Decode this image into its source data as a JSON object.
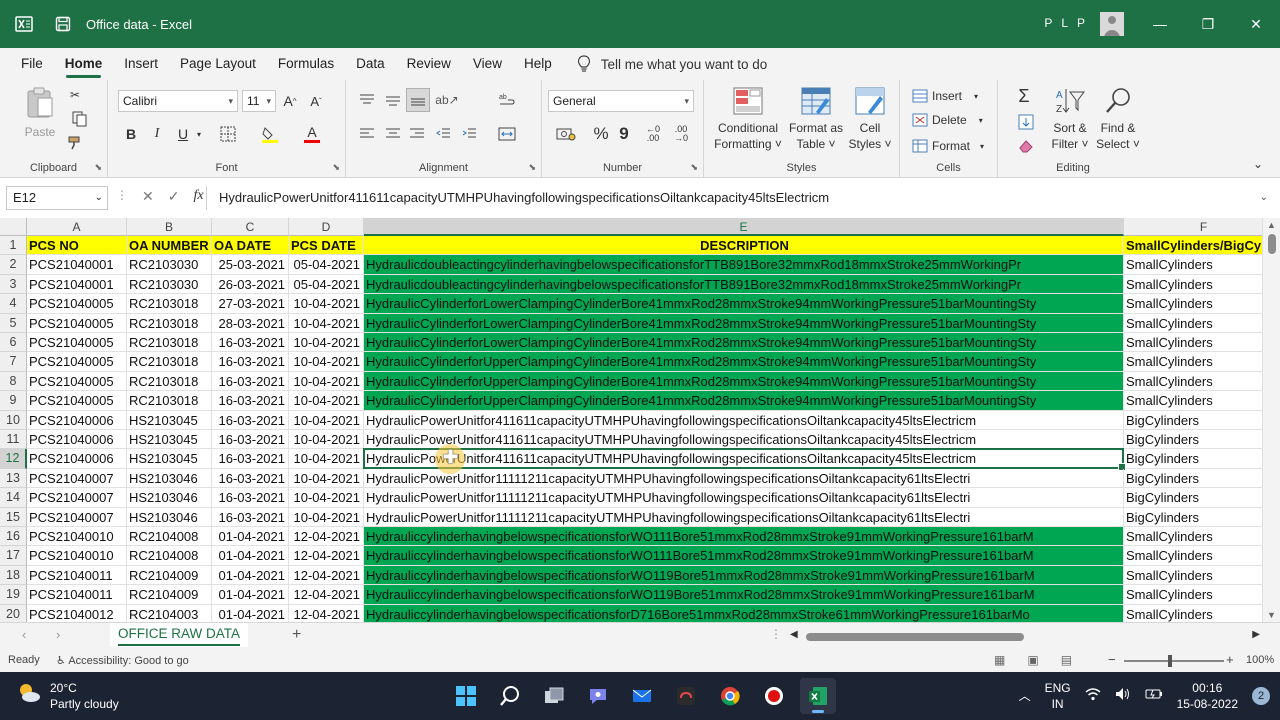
{
  "titlebar": {
    "doc_title": "Office data  -  Excel",
    "user": "P L P",
    "minimize": "—",
    "restore": "❐",
    "close": "✕"
  },
  "menu": {
    "tabs": [
      "File",
      "Home",
      "Insert",
      "Page Layout",
      "Formulas",
      "Data",
      "Review",
      "View",
      "Help"
    ],
    "tellme": "Tell me what you want to do"
  },
  "ribbon": {
    "clipboard": {
      "label": "Clipboard",
      "paste": "Paste"
    },
    "font": {
      "label": "Font",
      "name": "Calibri",
      "size": "11",
      "bold": "B",
      "italic": "I",
      "underline": "U"
    },
    "alignment": {
      "label": "Alignment"
    },
    "number": {
      "label": "Number",
      "format": "General",
      "percent": "%",
      "comma": "9"
    },
    "styles": {
      "label": "Styles",
      "conditional": [
        "Conditional",
        "Formatting ˅"
      ],
      "format_table": [
        "Format as",
        "Table ˅"
      ],
      "cell_styles": [
        "Cell",
        "Styles ˅"
      ]
    },
    "cells": {
      "label": "Cells",
      "insert": "Insert",
      "delete": "Delete",
      "format": "Format"
    },
    "editing": {
      "label": "Editing",
      "sort": [
        "Sort &",
        "Filter ˅"
      ],
      "find": [
        "Find &",
        "Select ˅"
      ]
    }
  },
  "formula_bar": {
    "name_box": "E12",
    "content": "HydraulicPowerUnitfor411611capacityUTMHPUhavingfollowingspecificationsOiltankcapacity45ltsElectricm"
  },
  "columns": [
    "A",
    "B",
    "C",
    "D",
    "E",
    "F"
  ],
  "rows": [
    {
      "n": "1",
      "a": "PCS NO",
      "b": "OA NUMBER",
      "c": "OA DATE",
      "d": "PCS DATE",
      "e": "DESCRIPTION",
      "f": "SmallCylinders/BigCylinders",
      "hdr": true
    },
    {
      "n": "2",
      "a": "PCS21040001",
      "b": "RC2103030",
      "c": "25-03-2021",
      "d": "05-04-2021",
      "e": "HydraulicdoubleactingcylinderhavingbelowspecificationsforTTB891Bore32mmxRod18mmxStroke25mmWorkingPr",
      "f": "SmallCylinders",
      "green": true
    },
    {
      "n": "3",
      "a": "PCS21040001",
      "b": "RC2103030",
      "c": "26-03-2021",
      "d": "05-04-2021",
      "e": "HydraulicdoubleactingcylinderhavingbelowspecificationsforTTB891Bore32mmxRod18mmxStroke25mmWorkingPr",
      "f": "SmallCylinders",
      "green": true
    },
    {
      "n": "4",
      "a": "PCS21040005",
      "b": "RC2103018",
      "c": "27-03-2021",
      "d": "10-04-2021",
      "e": "HydraulicCylinderforLowerClampingCylinderBore41mmxRod28mmxStroke94mmWorkingPressure51barMountingSty",
      "f": "SmallCylinders",
      "green": true
    },
    {
      "n": "5",
      "a": "PCS21040005",
      "b": "RC2103018",
      "c": "28-03-2021",
      "d": "10-04-2021",
      "e": "HydraulicCylinderforLowerClampingCylinderBore41mmxRod28mmxStroke94mmWorkingPressure51barMountingSty",
      "f": "SmallCylinders",
      "green": true
    },
    {
      "n": "6",
      "a": "PCS21040005",
      "b": "RC2103018",
      "c": "16-03-2021",
      "d": "10-04-2021",
      "e": "HydraulicCylinderforLowerClampingCylinderBore41mmxRod28mmxStroke94mmWorkingPressure51barMountingSty",
      "f": "SmallCylinders",
      "green": true
    },
    {
      "n": "7",
      "a": "PCS21040005",
      "b": "RC2103018",
      "c": "16-03-2021",
      "d": "10-04-2021",
      "e": "HydraulicCylinderforUpperClampingCylinderBore41mmxRod28mmxStroke94mmWorkingPressure51barMountingSty",
      "f": "SmallCylinders",
      "green": true
    },
    {
      "n": "8",
      "a": "PCS21040005",
      "b": "RC2103018",
      "c": "16-03-2021",
      "d": "10-04-2021",
      "e": "HydraulicCylinderforUpperClampingCylinderBore41mmxRod28mmxStroke94mmWorkingPressure51barMountingSty",
      "f": "SmallCylinders",
      "green": true
    },
    {
      "n": "9",
      "a": "PCS21040005",
      "b": "RC2103018",
      "c": "16-03-2021",
      "d": "10-04-2021",
      "e": "HydraulicCylinderforUpperClampingCylinderBore41mmxRod28mmxStroke94mmWorkingPressure51barMountingSty",
      "f": "SmallCylinders",
      "green": true
    },
    {
      "n": "10",
      "a": "PCS21040006",
      "b": "HS2103045",
      "c": "16-03-2021",
      "d": "10-04-2021",
      "e": "HydraulicPowerUnitfor411611capacityUTMHPUhavingfollowingspecificationsOiltankcapacity45ltsElectricm",
      "f": "BigCylinders"
    },
    {
      "n": "11",
      "a": "PCS21040006",
      "b": "HS2103045",
      "c": "16-03-2021",
      "d": "10-04-2021",
      "e": "HydraulicPowerUnitfor411611capacityUTMHPUhavingfollowingspecificationsOiltankcapacity45ltsElectricm",
      "f": "BigCylinders"
    },
    {
      "n": "12",
      "a": "PCS21040006",
      "b": "HS2103045",
      "c": "16-03-2021",
      "d": "10-04-2021",
      "e": "HydraulicPowerUnitfor411611capacityUTMHPUhavingfollowingspecificationsOiltankcapacity45ltsElectricm",
      "f": "BigCylinders",
      "active": true
    },
    {
      "n": "13",
      "a": "PCS21040007",
      "b": "HS2103046",
      "c": "16-03-2021",
      "d": "10-04-2021",
      "e": "HydraulicPowerUnitfor11111211capacityUTMHPUhavingfollowingspecificationsOiltankcapacity61ltsElectri",
      "f": "BigCylinders"
    },
    {
      "n": "14",
      "a": "PCS21040007",
      "b": "HS2103046",
      "c": "16-03-2021",
      "d": "10-04-2021",
      "e": "HydraulicPowerUnitfor11111211capacityUTMHPUhavingfollowingspecificationsOiltankcapacity61ltsElectri",
      "f": "BigCylinders"
    },
    {
      "n": "15",
      "a": "PCS21040007",
      "b": "HS2103046",
      "c": "16-03-2021",
      "d": "10-04-2021",
      "e": "HydraulicPowerUnitfor11111211capacityUTMHPUhavingfollowingspecificationsOiltankcapacity61ltsElectri",
      "f": "BigCylinders"
    },
    {
      "n": "16",
      "a": "PCS21040010",
      "b": "RC2104008",
      "c": "01-04-2021",
      "d": "12-04-2021",
      "e": "HydrauliccylinderhavingbelowspecificationsforWO111Bore51mmxRod28mmxStroke91mmWorkingPressure161barM",
      "f": "SmallCylinders",
      "green": true
    },
    {
      "n": "17",
      "a": "PCS21040010",
      "b": "RC2104008",
      "c": "01-04-2021",
      "d": "12-04-2021",
      "e": "HydrauliccylinderhavingbelowspecificationsforWO111Bore51mmxRod28mmxStroke91mmWorkingPressure161barM",
      "f": "SmallCylinders",
      "green": true
    },
    {
      "n": "18",
      "a": "PCS21040011",
      "b": "RC2104009",
      "c": "01-04-2021",
      "d": "12-04-2021",
      "e": "HydrauliccylinderhavingbelowspecificationsforWO119Bore51mmxRod28mmxStroke91mmWorkingPressure161barM",
      "f": "SmallCylinders",
      "green": true
    },
    {
      "n": "19",
      "a": "PCS21040011",
      "b": "RC2104009",
      "c": "01-04-2021",
      "d": "12-04-2021",
      "e": "HydrauliccylinderhavingbelowspecificationsforWO119Bore51mmxRod28mmxStroke91mmWorkingPressure161barM",
      "f": "SmallCylinders",
      "green": true
    },
    {
      "n": "20",
      "a": "PCS21040012",
      "b": "RC2104003",
      "c": "01-04-2021",
      "d": "12-04-2021",
      "e": "HydrauliccylinderhavingbelowspecificationsforD716Bore51mmxRod28mmxStroke61mmWorkingPressure161barMo",
      "f": "SmallCylinders",
      "green": true
    }
  ],
  "sheet": {
    "tab": "OFFICE RAW DATA",
    "add": "+"
  },
  "status": {
    "ready": "Ready",
    "accessibility": "Accessibility: Good to go",
    "zoom": "100%",
    "zoom_minus": "−",
    "zoom_plus": "+"
  },
  "taskbar": {
    "temp": "20°C",
    "weather": "Partly cloudy",
    "lang1": "ENG",
    "lang2": "IN",
    "time": "00:16",
    "date": "15-08-2022",
    "notifications": "2"
  },
  "colors": {
    "excel_green": "#1e7145",
    "header_yellow": "#ffff00",
    "row_green": "#00a651"
  }
}
